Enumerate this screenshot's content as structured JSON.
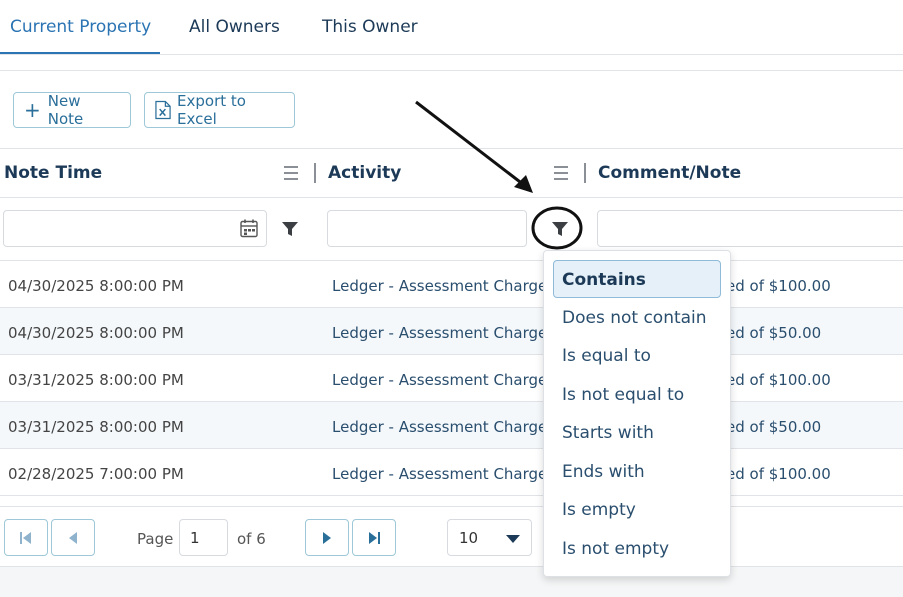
{
  "tabs": [
    {
      "label": "Current Property",
      "active": true
    },
    {
      "label": "All Owners",
      "active": false
    },
    {
      "label": "This Owner",
      "active": false
    }
  ],
  "toolbar": {
    "new_note_label": "New Note",
    "export_label": "Export to Excel"
  },
  "grid": {
    "columns": [
      "Note Time",
      "Activity",
      "Comment/Note"
    ],
    "rows": [
      {
        "time": "04/30/2025 8:00:00 PM",
        "activity": "Ledger - Assessment Charge",
        "comment": "ed of $100.00"
      },
      {
        "time": "04/30/2025 8:00:00 PM",
        "activity": "Ledger - Assessment Charge",
        "comment": "ed of $50.00"
      },
      {
        "time": "03/31/2025 8:00:00 PM",
        "activity": "Ledger - Assessment Charge",
        "comment": "ed of $100.00"
      },
      {
        "time": "03/31/2025 8:00:00 PM",
        "activity": "Ledger - Assessment Charge",
        "comment": "ed of $50.00"
      },
      {
        "time": "02/28/2025 7:00:00 PM",
        "activity": "Ledger - Assessment Charge",
        "comment": "ed of $100.00"
      }
    ]
  },
  "pager": {
    "page_label": "Page",
    "current_page": "1",
    "of_label": "of 6",
    "page_size": "10"
  },
  "filter_menu": {
    "options": [
      "Contains",
      "Does not contain",
      "Is equal to",
      "Is not equal to",
      "Starts with",
      "Ends with",
      "Is empty",
      "Is not empty"
    ],
    "selected": "Contains"
  },
  "colors": {
    "accent": "#2b74b3",
    "header_text": "#1c3a57",
    "button_border": "#9ec8d8"
  }
}
